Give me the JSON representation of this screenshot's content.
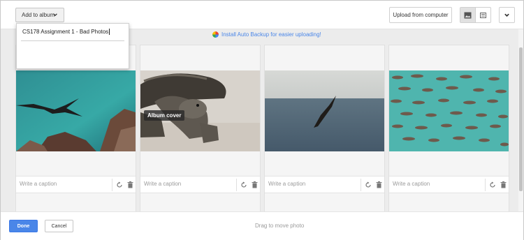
{
  "toolbar": {
    "add_to_album_label": "Add to album",
    "upload_label": "Upload from computer"
  },
  "album_dropdown": {
    "album_name_value": "CS178 Assignment 1 - Bad Photos"
  },
  "banner": {
    "auto_backup_text": "Install Auto Backup for easier uploading!"
  },
  "photos": [
    {
      "caption_placeholder": "Write a caption",
      "subject": "frigatebird over rocky coast"
    },
    {
      "caption_placeholder": "Write a caption",
      "subject": "giant tortoise",
      "badge": "Album cover"
    },
    {
      "caption_placeholder": "Write a caption",
      "subject": "bird over ocean"
    },
    {
      "caption_placeholder": "Write a caption",
      "subject": "flock of birds over water"
    }
  ],
  "footer": {
    "done_label": "Done",
    "cancel_label": "Cancel",
    "drag_hint": "Drag to move photo"
  },
  "colors": {
    "accent": "#4a86e8",
    "content_background": "#ececec"
  },
  "icons": [
    "chevron-down-icon",
    "image-view-icon",
    "card-view-icon",
    "pinwheel-icon",
    "rotate-icon",
    "trash-icon"
  ]
}
